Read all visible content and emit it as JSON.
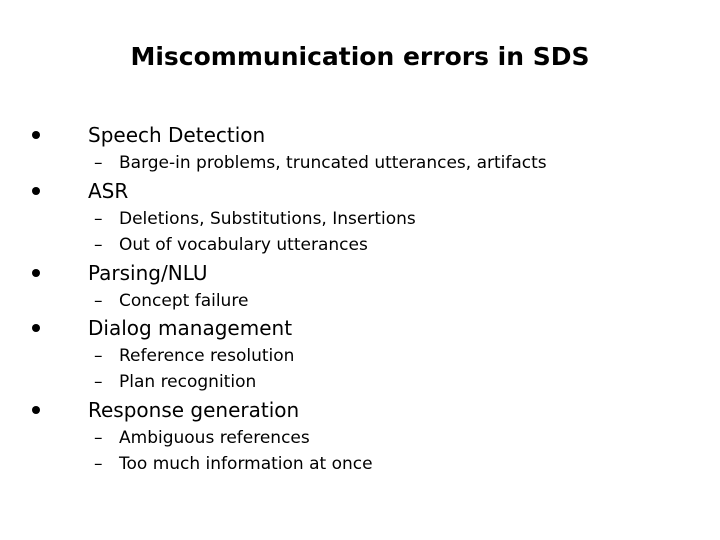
{
  "slide": {
    "title": "Miscommunication errors in SDS",
    "bullet_glyph": "•",
    "dash_glyph": "–",
    "items": [
      {
        "label": "Speech Detection",
        "subitems": [
          "Barge-in problems, truncated utterances, artifacts"
        ]
      },
      {
        "label": "ASR",
        "subitems": [
          "Deletions, Substitutions, Insertions",
          "Out of vocabulary utterances"
        ]
      },
      {
        "label": "Parsing/NLU",
        "subitems": [
          "Concept failure"
        ]
      },
      {
        "label": "Dialog management",
        "subitems": [
          "Reference resolution",
          "Plan recognition"
        ]
      },
      {
        "label": "Response generation",
        "subitems": [
          "Ambiguous references",
          "Too much information at once"
        ]
      }
    ]
  }
}
